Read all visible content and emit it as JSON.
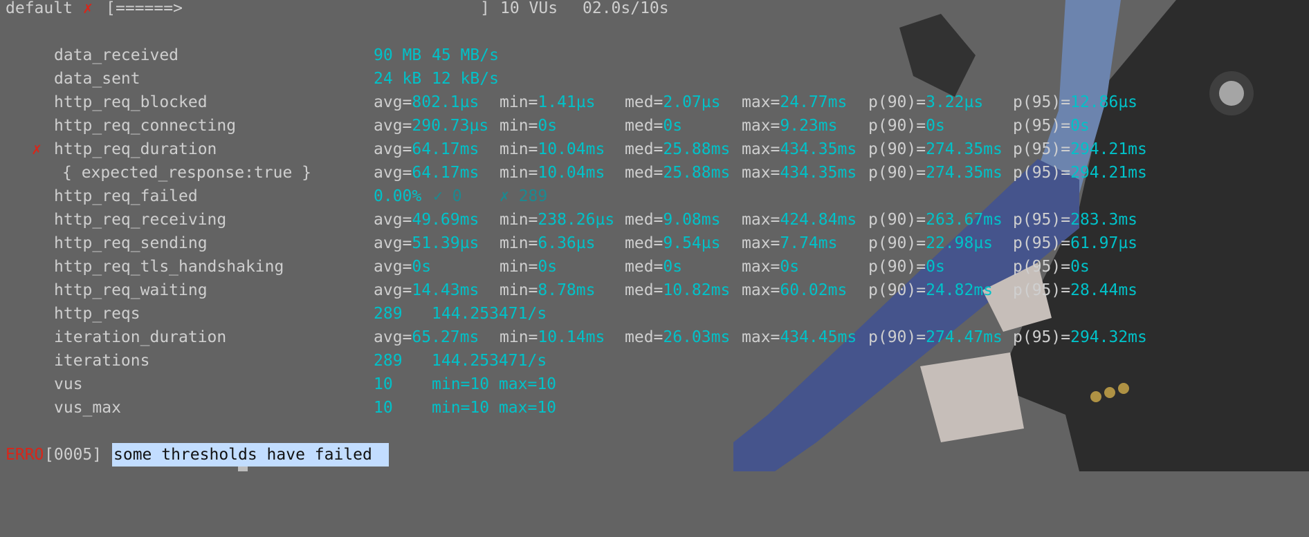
{
  "header": {
    "scenario": "default",
    "fail_marker": "✗",
    "progress_open": "[",
    "progress_bar": "======>",
    "progress_close": "]",
    "progress_fraction": 0.2,
    "vus": "10 VUs",
    "elapsed": "02.0s/10s"
  },
  "colors": {
    "background": "#636363",
    "value": "#00c2c9",
    "error": "#d8261a",
    "selection": "#c2ddff"
  },
  "metrics": [
    {
      "name": "data_received",
      "value": "90 MB",
      "rate": "45 MB/s"
    },
    {
      "name": "data_sent",
      "value": "24 kB",
      "rate": "12 kB/s"
    },
    {
      "name": "http_req_blocked",
      "stats": {
        "avg": "802.1µs",
        "min": "1.41µs",
        "med": "2.07µs",
        "max": "24.77ms",
        "p(90)": "3.22µs",
        "p(95)": "12.86µs"
      }
    },
    {
      "name": "http_req_connecting",
      "stats": {
        "avg": "290.73µs",
        "min": "0s",
        "med": "0s",
        "max": "9.23ms",
        "p(90)": "0s",
        "p(95)": "0s"
      }
    },
    {
      "name": "http_req_duration",
      "marker": "✗",
      "stats": {
        "avg": "64.17ms",
        "min": "10.04ms",
        "med": "25.88ms",
        "max": "434.35ms",
        "p(90)": "274.35ms",
        "p(95)": "294.21ms"
      }
    },
    {
      "name": "{ expected_response:true }",
      "sub": true,
      "stats": {
        "avg": "64.17ms",
        "min": "10.04ms",
        "med": "25.88ms",
        "max": "434.35ms",
        "p(90)": "274.35ms",
        "p(95)": "294.21ms"
      }
    },
    {
      "name": "http_req_failed",
      "rate_pct": "0.00%",
      "passes": "✓ 0",
      "fails": "✗ 289"
    },
    {
      "name": "http_req_receiving",
      "stats": {
        "avg": "49.69ms",
        "min": "238.26µs",
        "med": "9.08ms",
        "max": "424.84ms",
        "p(90)": "263.67ms",
        "p(95)": "283.3ms"
      }
    },
    {
      "name": "http_req_sending",
      "stats": {
        "avg": "51.39µs",
        "min": "6.36µs",
        "med": "9.54µs",
        "max": "7.74ms",
        "p(90)": "22.98µs",
        "p(95)": "61.97µs"
      }
    },
    {
      "name": "http_req_tls_handshaking",
      "stats": {
        "avg": "0s",
        "min": "0s",
        "med": "0s",
        "max": "0s",
        "p(90)": "0s",
        "p(95)": "0s"
      }
    },
    {
      "name": "http_req_waiting",
      "stats": {
        "avg": "14.43ms",
        "min": "8.78ms",
        "med": "10.82ms",
        "max": "60.02ms",
        "p(90)": "24.82ms",
        "p(95)": "28.44ms"
      }
    },
    {
      "name": "http_reqs",
      "value": "289",
      "rate": "144.253471/s"
    },
    {
      "name": "iteration_duration",
      "stats": {
        "avg": "65.27ms",
        "min": "10.14ms",
        "med": "26.03ms",
        "max": "434.45ms",
        "p(90)": "274.47ms",
        "p(95)": "294.32ms"
      }
    },
    {
      "name": "iterations",
      "value": "289",
      "rate": "144.253471/s"
    },
    {
      "name": "vus",
      "value": "10",
      "rate": "min=10 max=10"
    },
    {
      "name": "vus_max",
      "value": "10",
      "rate": "min=10 max=10"
    }
  ],
  "error": {
    "level": "ERRO",
    "code": "[0005]",
    "message": "some thresholds have failed"
  }
}
